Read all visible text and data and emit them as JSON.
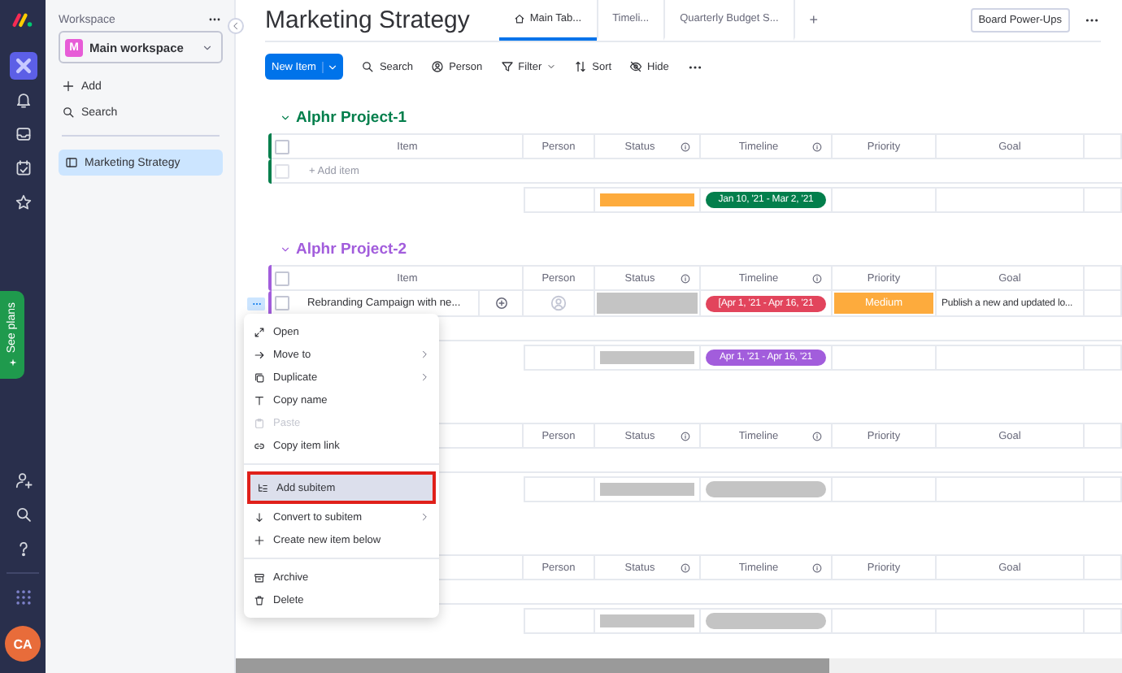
{
  "rail": {
    "items": [
      {
        "selected": true
      },
      {
        "selected": false
      },
      {
        "selected": false
      },
      {
        "selected": false
      },
      {
        "selected": false
      }
    ],
    "promo": "See plans",
    "avatar": "CA"
  },
  "workspace": {
    "label": "Workspace",
    "initial": "M",
    "name": "Main workspace",
    "actions": [
      "Add",
      "Search"
    ],
    "boards": [
      {
        "label": "Marketing Strategy",
        "selected": true
      }
    ]
  },
  "board": {
    "title": "Marketing Strategy",
    "tabs": [
      {
        "label": "Main Tab...",
        "selected": true
      },
      {
        "label": "Timeli...",
        "selected": false
      },
      {
        "label": "Quarterly Budget S...",
        "selected": false
      }
    ],
    "add_tab": "+",
    "power_ups": "Board Power-Ups"
  },
  "toolbar": {
    "new_item": "New Item",
    "tools": [
      {
        "label": "Search",
        "dropdown": false
      },
      {
        "label": "Person",
        "dropdown": false
      },
      {
        "label": "Filter",
        "dropdown": true
      },
      {
        "label": "Sort",
        "dropdown": false
      },
      {
        "label": "Hide",
        "dropdown": false
      }
    ]
  },
  "groups": [
    {
      "name": "Alphr Project-1",
      "color": "#037f4c",
      "checked": false,
      "columns": [
        {
          "label": "Item",
          "info": false
        },
        {
          "label": "Person",
          "info": false
        },
        {
          "label": "Status",
          "info": true
        },
        {
          "label": "Timeline",
          "info": true
        },
        {
          "label": "Priority",
          "info": false
        },
        {
          "label": "Goal",
          "info": false
        }
      ],
      "add_item": {
        "text": "+ Add item",
        "checked": false
      },
      "summary": {
        "status": {
          "color": "#fdab3d"
        },
        "timeline": {
          "text": "Jan 10, '21 - Mar 2, '21",
          "color": "#037f4c"
        }
      }
    },
    {
      "name": "Alphr Project-2",
      "color": "#a25ddc",
      "checked": false,
      "columns": [
        {
          "label": "Item",
          "info": false
        },
        {
          "label": "Person",
          "info": false
        },
        {
          "label": "Status",
          "info": true
        },
        {
          "label": "Timeline",
          "info": true
        },
        {
          "label": "Priority",
          "info": false
        },
        {
          "label": "Goal",
          "info": false
        }
      ],
      "rows": [
        {
          "name": "Rebranding Campaign with ne...",
          "checked": false,
          "menu_open": true,
          "status": {
            "color": "#c4c4c4"
          },
          "timeline": {
            "text": "[Apr 1, '21 - Apr 16, '21",
            "color": "#e2445c"
          },
          "priority": {
            "text": "Medium",
            "color": "#fdab3d"
          },
          "goal": "Publish a new and updated lo..."
        }
      ],
      "summary": {
        "status": {
          "color": "#c4c4c4"
        },
        "timeline": {
          "text": "Apr 1, '21 - Apr 16, '21",
          "color": "#a25ddc"
        }
      }
    },
    {
      "columns": [
        {
          "info": false
        },
        {
          "label": "Person",
          "info": false
        },
        {
          "label": "Status",
          "info": true
        },
        {
          "label": "Timeline",
          "info": true
        },
        {
          "label": "Priority",
          "info": false
        },
        {
          "label": "Goal",
          "info": false
        }
      ],
      "summary": {
        "status": {
          "color": "#c4c4c4"
        },
        "timeline": {
          "color": "#c4c4c4"
        }
      }
    },
    {
      "columns": [
        {
          "info": false
        },
        {
          "label": "Person",
          "info": false
        },
        {
          "label": "Status",
          "info": true
        },
        {
          "label": "Timeline",
          "info": true
        },
        {
          "label": "Priority",
          "info": false
        },
        {
          "label": "Goal",
          "info": false
        }
      ],
      "summary": {
        "status": {
          "color": "#c4c4c4"
        },
        "timeline": {
          "color": "#c4c4c4"
        }
      }
    }
  ],
  "context_menu": {
    "sections": [
      [
        {
          "label": "Open",
          "submenu": false,
          "disabled": false,
          "highlighted": false
        },
        {
          "label": "Move to",
          "submenu": true,
          "disabled": false,
          "highlighted": false
        },
        {
          "label": "Duplicate",
          "submenu": true,
          "disabled": false,
          "highlighted": false
        },
        {
          "label": "Copy name",
          "submenu": false,
          "disabled": false,
          "highlighted": false
        },
        {
          "label": "Paste",
          "submenu": false,
          "disabled": true,
          "highlighted": false
        },
        {
          "label": "Copy item link",
          "submenu": false,
          "disabled": false,
          "highlighted": false
        }
      ],
      [
        {
          "label": "Add subitem",
          "submenu": false,
          "disabled": false,
          "highlighted": true
        },
        {
          "label": "Convert to subitem",
          "submenu": true,
          "disabled": false,
          "highlighted": false
        },
        {
          "label": "Create new item below",
          "submenu": false,
          "disabled": false,
          "highlighted": false
        }
      ],
      [
        {
          "label": "Archive",
          "submenu": false,
          "disabled": false,
          "highlighted": false
        },
        {
          "label": "Delete",
          "submenu": false,
          "disabled": false,
          "highlighted": false
        }
      ]
    ]
  }
}
